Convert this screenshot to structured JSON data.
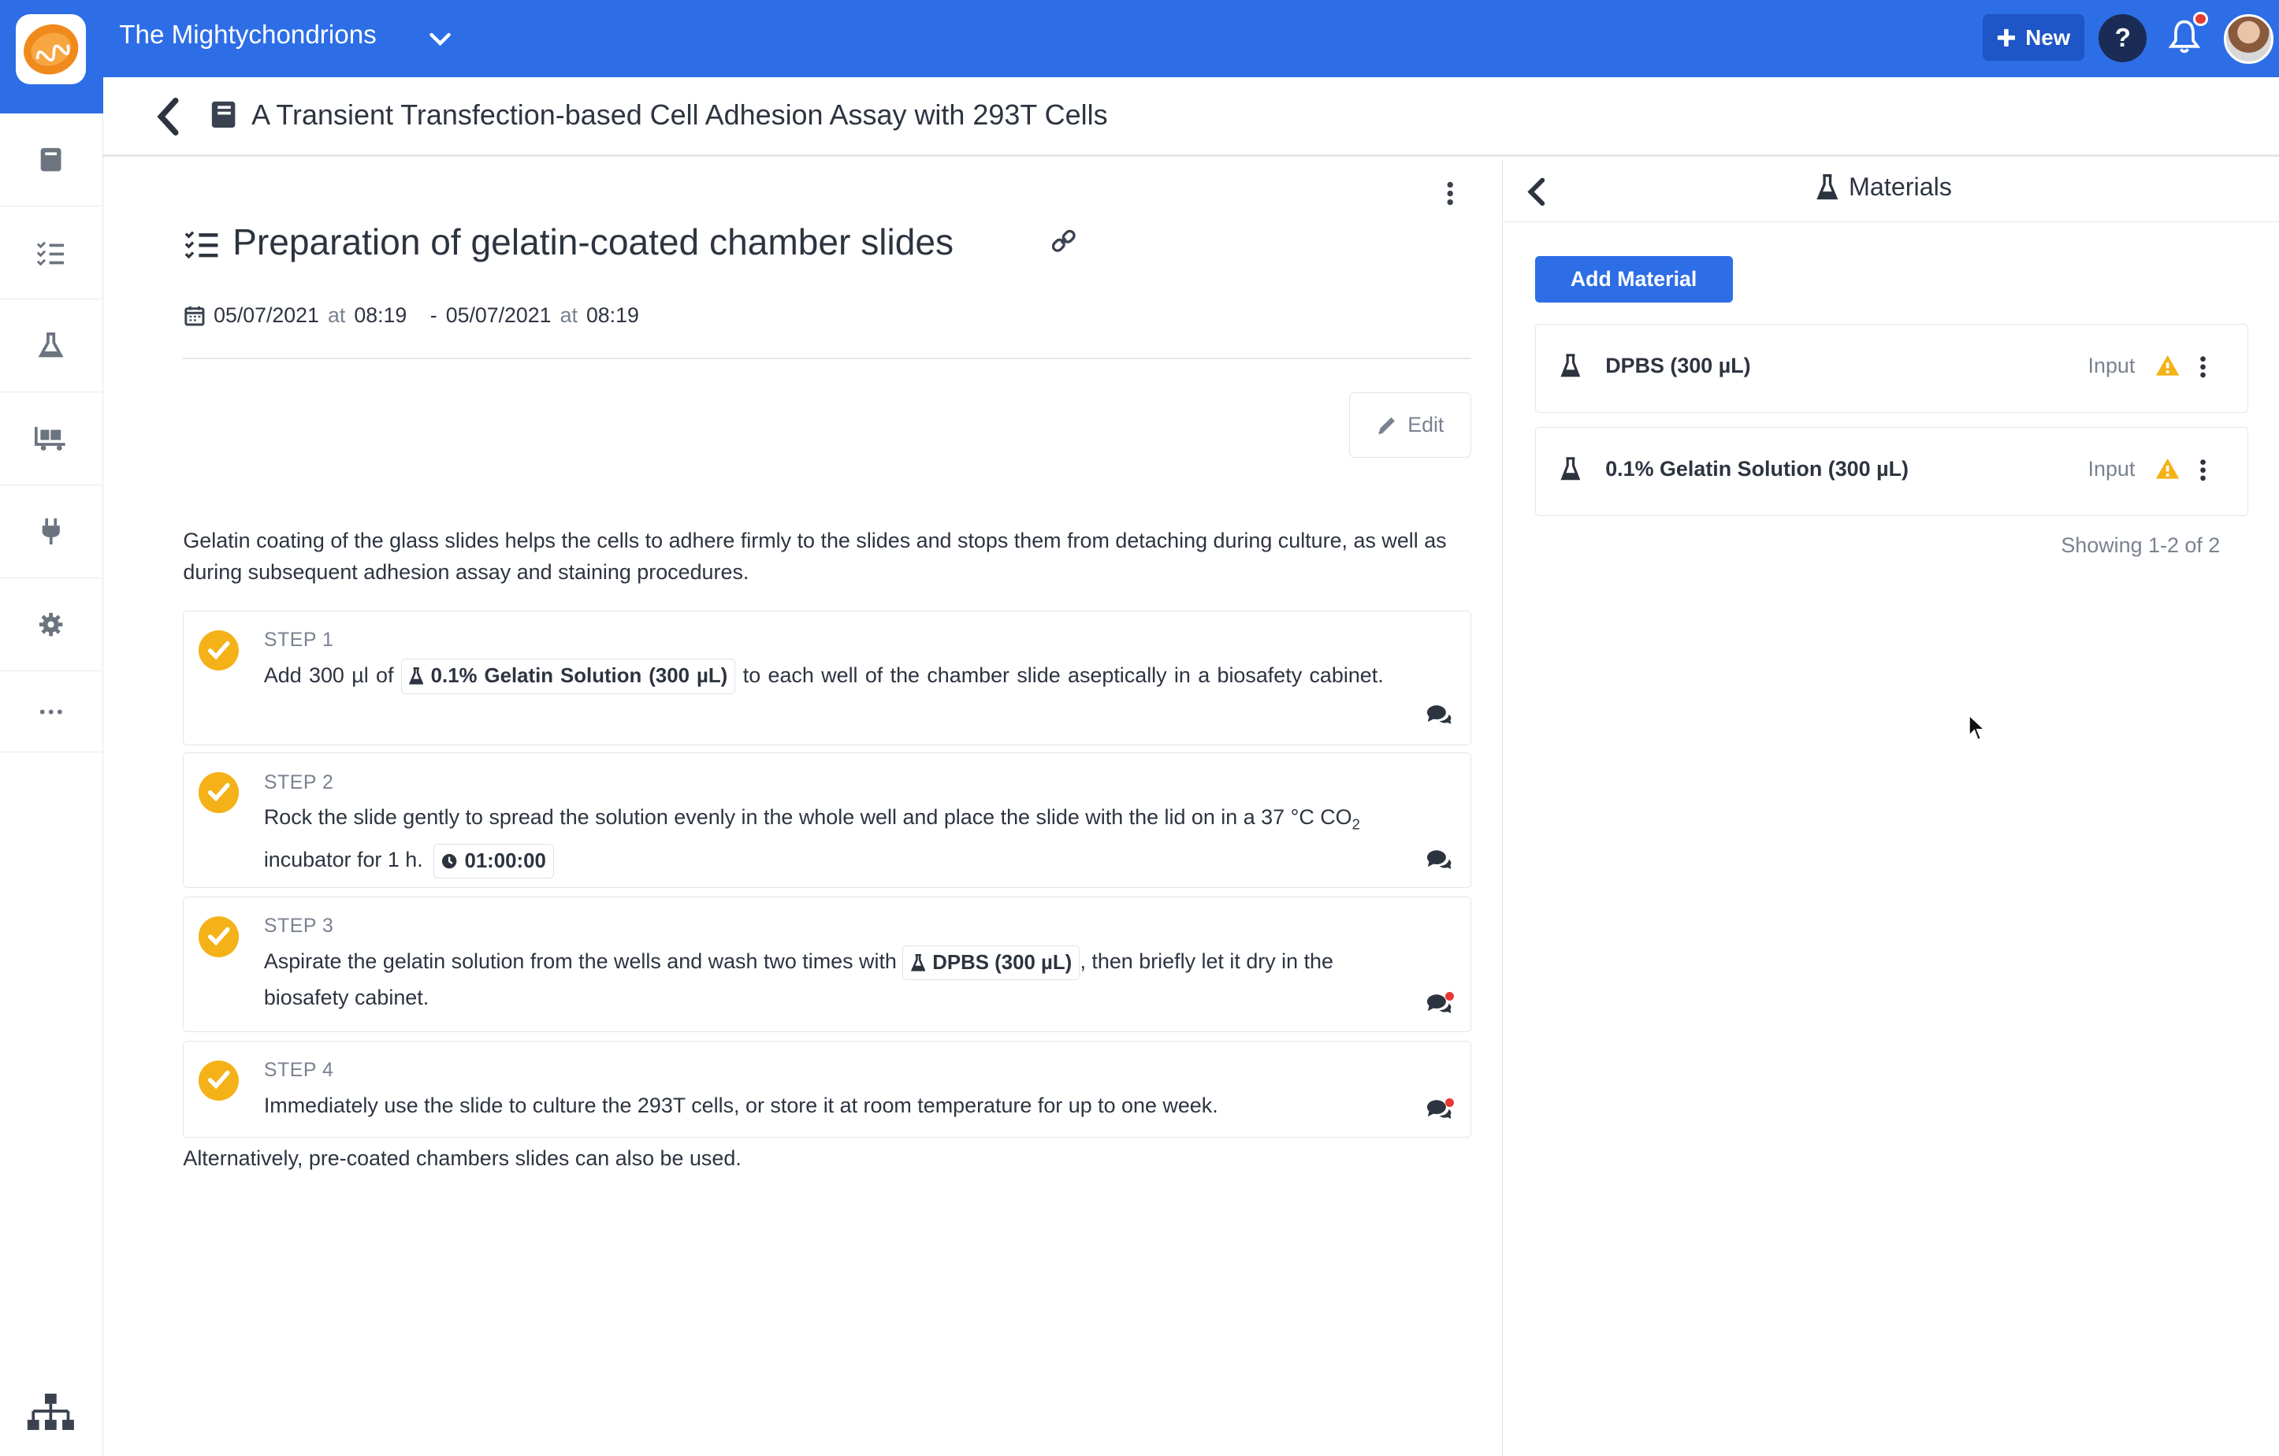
{
  "header": {
    "team_name": "The Mightychondrions",
    "new_label": "New",
    "help_label": "?",
    "accent": "#2d6ee6"
  },
  "sidebar": {
    "items": [
      "notebook-icon",
      "checklist-icon",
      "flask-icon",
      "cart-icon",
      "plug-icon",
      "gear-icon",
      "more-icon"
    ],
    "bottom": "org-chart-icon"
  },
  "document": {
    "title": "A Transient Transfection-based Cell Adhesion Assay with 293T Cells"
  },
  "section": {
    "title": "Preparation of gelatin-coated chamber slides",
    "start_date": "05/07/2021",
    "start_at": "at",
    "start_time": "08:19",
    "separator": "-",
    "end_date": "05/07/2021",
    "end_at": "at",
    "end_time": "08:19",
    "edit_label": "Edit",
    "description": "Gelatin coating of the glass slides helps the cells to adhere firmly to the slides and stops them from detaching during culture, as well as during subsequent adhesion assay and staining procedures.",
    "alternative": "Alternatively, pre-coated chambers slides can also be used."
  },
  "steps": [
    {
      "label": "STEP 1",
      "text_before": "Add 300 µl of",
      "chip": "0.1% Gelatin Solution (300 µL)",
      "text_after": "to each well of the chamber slide aseptically in a biosafety cabinet."
    },
    {
      "label": "STEP 2",
      "text_before": "Rock the slide gently to spread the solution evenly in the whole well and place the slide with the lid on in a 37 °C CO",
      "sub": "2",
      "text_after": " incubator for 1 h.",
      "timer": "01:00:00"
    },
    {
      "label": "STEP 3",
      "text_before": "Aspirate the gelatin solution from the wells and wash two times with",
      "chip": "DPBS (300 µL)",
      "text_after": ", then briefly let it dry in the biosafety cabinet."
    },
    {
      "label": "STEP 4",
      "text": "Immediately use the slide to culture the 293T cells, or store it at room temperature for up to one week."
    }
  ],
  "materials": {
    "title": "Materials",
    "add_label": "Add Material",
    "items": [
      {
        "name": "DPBS (300 µL)",
        "type": "Input"
      },
      {
        "name": "0.1% Gelatin Solution (300 µL)",
        "type": "Input"
      }
    ],
    "showing": "Showing 1-2 of 2"
  }
}
